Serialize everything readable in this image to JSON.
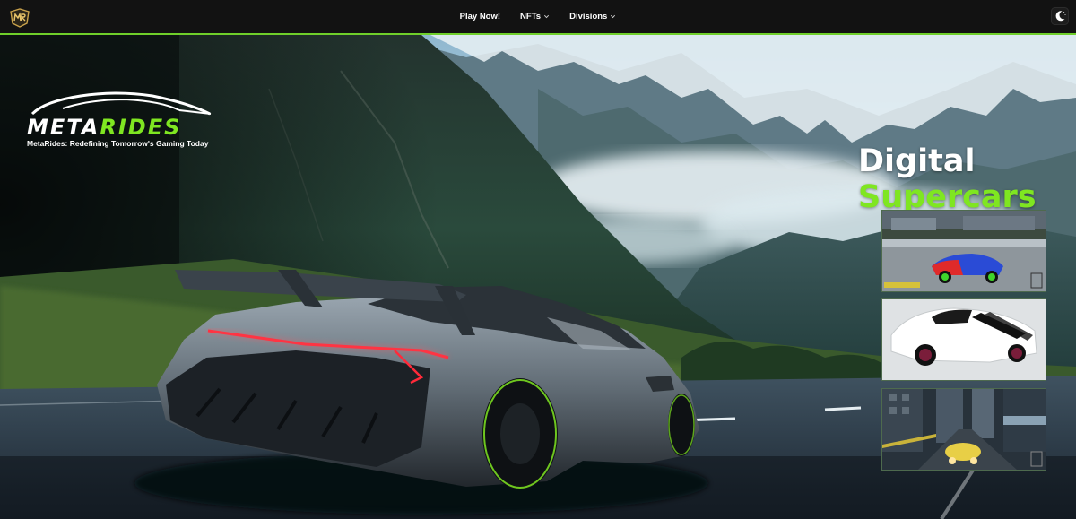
{
  "nav": {
    "items": [
      {
        "label": "Play Now!",
        "has_dropdown": false
      },
      {
        "label": "NFTs",
        "has_dropdown": true
      },
      {
        "label": "Divisions",
        "has_dropdown": true
      }
    ],
    "icons": {
      "logo": "mr-logo-badge",
      "theme_toggle": "moon-icon",
      "dropdown": "chevron-down-icon"
    }
  },
  "brand": {
    "word_part1": "META",
    "word_part2": "RIDES",
    "tagline": "MetaRides: Redefining Tomorrow's Gaming Today"
  },
  "headline": {
    "line1": "Digital",
    "line2": "Supercars"
  },
  "colors": {
    "accent_green": "#7fe621",
    "nav_bg": "#121212",
    "nav_border": "#6fcf2a",
    "text": "#ffffff"
  },
  "thumbnails": [
    {
      "icon": "blue-red-supercar-thumbnail"
    },
    {
      "icon": "white-supercar-thumbnail"
    },
    {
      "icon": "city-race-thumbnail"
    }
  ]
}
